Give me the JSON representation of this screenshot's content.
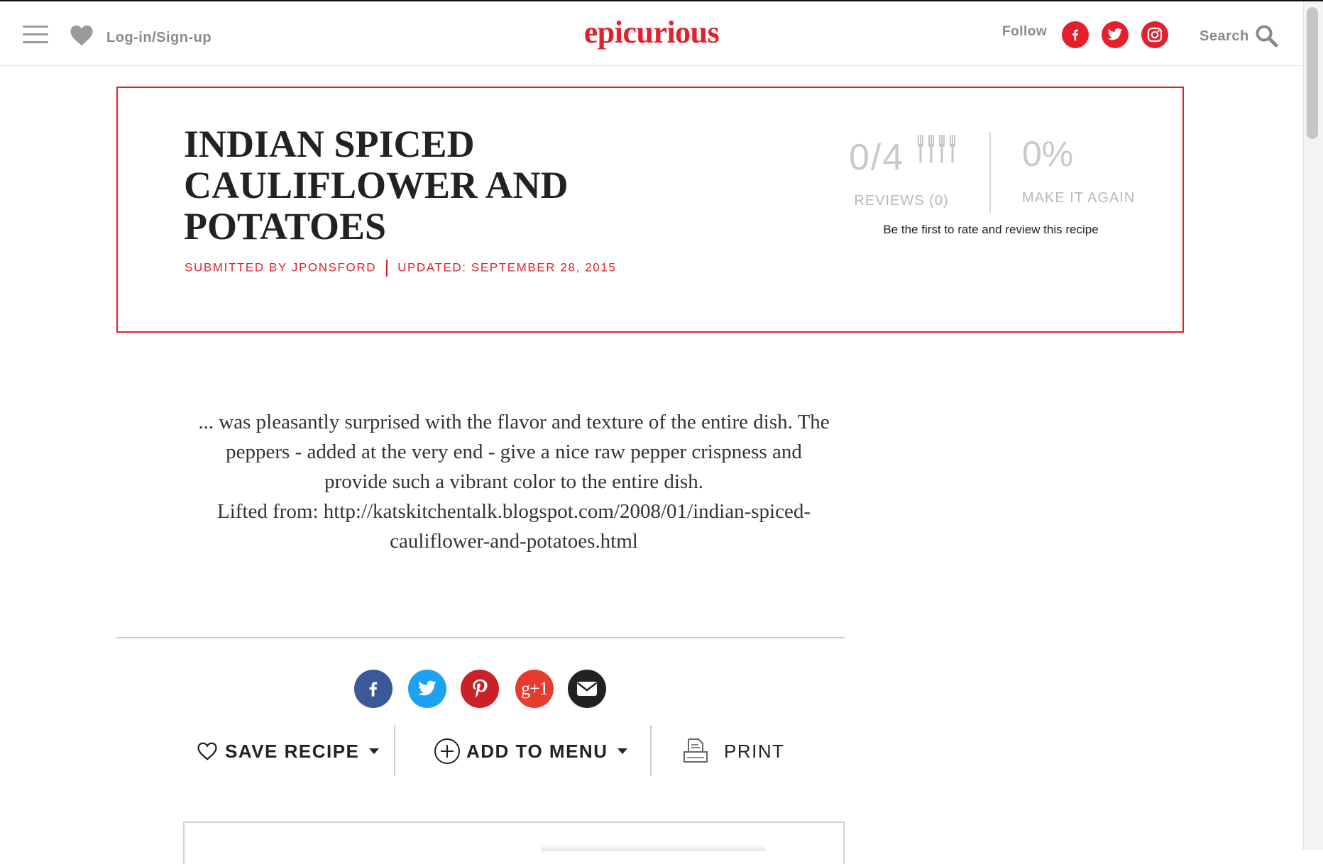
{
  "header": {
    "login_label": "Log-in/Sign-up",
    "logo": "epicurious",
    "follow_label": "Follow",
    "search_label": "Search",
    "social_icons": [
      "facebook-icon",
      "twitter-icon",
      "instagram-icon"
    ]
  },
  "recipe": {
    "title": "INDIAN SPICED CAULIFLOWER AND POTATOES",
    "submitted_by": "SUBMITTED BY JPONSFORD",
    "updated": "UPDATED: SEPTEMBER 28, 2015"
  },
  "rating": {
    "score": "0/4",
    "reviews_label": "REVIEWS (0)",
    "make_again_percent": "0%",
    "make_again_label": "MAKE IT AGAIN",
    "prompt": "Be the first to rate and review this recipe"
  },
  "description": {
    "text": "... was pleasantly surprised with the flavor and texture of the entire dish. The peppers - added at the very end - give a nice raw pepper crispness and provide such a vibrant color to the entire dish.",
    "source": "Lifted from: http://katskitchentalk.blogspot.com/2008/01/indian-spiced-cauliflower-and-potatoes.html"
  },
  "share": {
    "buttons": [
      "facebook-icon",
      "twitter-icon",
      "pinterest-icon",
      "google-plus-icon",
      "email-icon"
    ],
    "google_plus_label": "g+1"
  },
  "actions": {
    "save_label": "SAVE RECIPE",
    "menu_label": "ADD TO MENU",
    "print_label": "PRINT"
  },
  "colors": {
    "brand_red": "#e3202c",
    "facebook": "#3b5998",
    "twitter": "#1da1f2",
    "pinterest": "#cb2027",
    "google_plus": "#e53c2e",
    "email": "#222222"
  }
}
